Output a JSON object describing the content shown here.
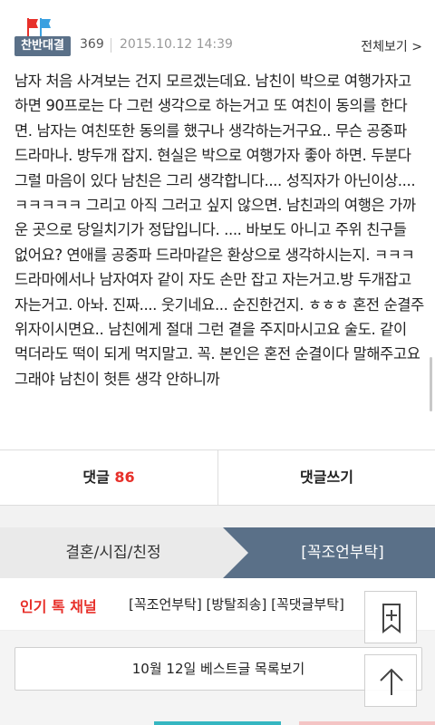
{
  "post": {
    "badge": "찬반대결",
    "count": "369",
    "date": "2015.10.12 14:39",
    "view_all": "전체보기 >",
    "body": "남자 처음 사겨보는 건지 모르겠는데요. 남친이 박으로 여행가자고 하면 90프로는 다 그런 생각으로 하는거고 또 여친이 동의를 한다면. 남자는 여친또한 동의를 했구나 생각하는거구요.. 무슨 공중파 드라마나. 방두개 잡지. 현실은 박으로 여행가자 좋아 하면. 두분다 그럴 마음이 있다 남친은 그리 생각합니다.... 성직자가 아닌이상.... ㅋㅋㅋㅋㅋ 그리고 아직 그러고 싶지 않으면. 남친과의 여행은 가까운 곳으로 당일치기가 정답입니다. .... 바보도 아니고 주위 친구들 없어요? 연애를 공중파 드라마같은 환상으로 생각하시는지. ㅋㅋㅋ 드라마에서나 남자여자 같이 자도 손만 잡고 자는거고.방 두개잡고 자는거고. 아놔. 진짜.... 웃기네요... 순진한건지. ㅎㅎㅎ 혼전 순결주위자이시면요.. 남친에게 절대 그런 곁을 주지마시고요 술도. 같이 먹더라도 떡이 되게 먹지말고. 꼭. 본인은 혼전 순결이다 말해주고요 그래야 남친이 헛튼 생각 안하니까"
  },
  "actions": {
    "comments_label": "댓글",
    "comments_count": "86",
    "write_label": "댓글쓰기"
  },
  "tabs": {
    "left": "결혼/시집/친정",
    "right": "[꼭조언부탁]"
  },
  "channel": {
    "title": "인기 톡 채널",
    "items": "[꼭조언부탁] [방탈죄송] [꼭댓글부탁]"
  },
  "best": {
    "label": "10월 12일 베스트글 목록보기"
  },
  "icons": {
    "flag": "flag-icon",
    "bookmark": "bookmark-add-icon",
    "top": "arrow-up-icon"
  },
  "colors": {
    "badge_bg": "#5a7088",
    "accent_red": "#e7302a",
    "tab_active": "#5a7088"
  }
}
